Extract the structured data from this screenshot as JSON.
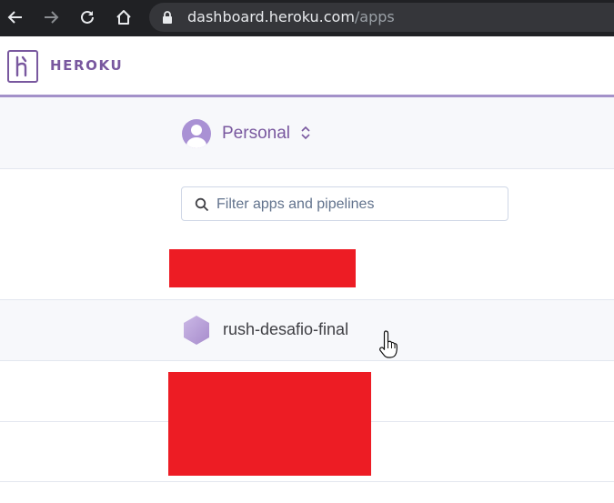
{
  "browser": {
    "url_host": "dashboard.heroku.com",
    "url_path": "/apps",
    "icons": [
      "back-icon",
      "forward-icon",
      "reload-icon",
      "home-icon",
      "lock-icon"
    ]
  },
  "header": {
    "brand": "HEROKU",
    "accent_color": "#79589f"
  },
  "context_switcher": {
    "label": "Personal"
  },
  "search": {
    "placeholder": "Filter apps and pipelines"
  },
  "apps": [
    {
      "name": "rush-desafio-final",
      "redacted": false
    }
  ],
  "redaction_color": "#ed1c24"
}
